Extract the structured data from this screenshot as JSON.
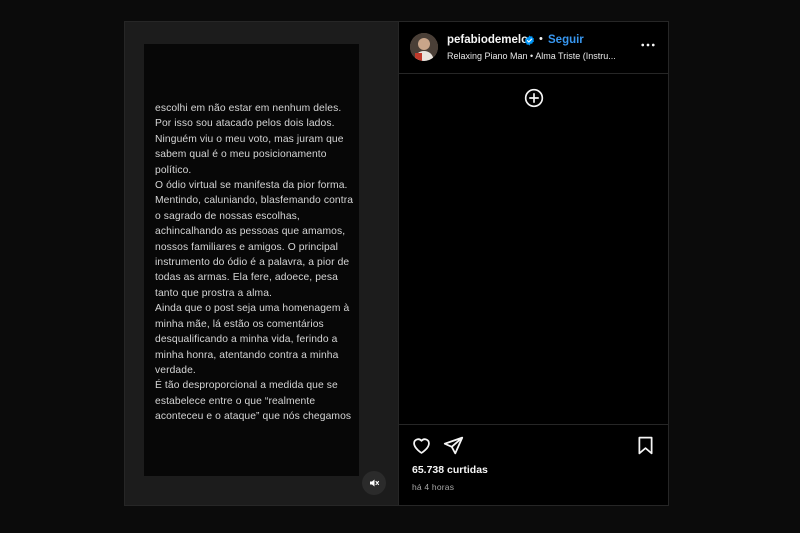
{
  "post": {
    "video": {
      "text": "escolhi em não estar em nenhum deles.\nPor isso sou atacado pelos dois lados.\nNinguém viu o meu voto, mas juram que sabem qual é o meu posicionamento político.\nO ódio virtual se manifesta da pior forma. Mentindo, caluniando, blasfemando contra o sagrado de nossas escolhas, achincalhando as pessoas que amamos, nossos familiares e amigos. O principal instrumento do ódio é a palavra, a pior de todas as armas. Ela fere, adoece, pesa tanto que prostra a alma.\nAinda que o post seja uma homenagem à minha mãe, lá estão os comentários desqualificando a minha vida, ferindo a minha honra, atentando contra a minha verdade.\nÉ tão desproporcional a medida que se estabelece entre o que “realmente aconteceu e o ataque” que nós chegamos",
      "mute_icon": "muted-speaker-icon"
    },
    "header": {
      "username": "pefabiodemelo",
      "separator": "•",
      "follow_label": "Seguir",
      "audio": "Relaxing Piano Man • Alma Triste (Instru...",
      "verified_color": "#0095f6",
      "follow_color": "#3897f0"
    },
    "actions": {
      "likes": "65.738 curtidas",
      "time": "há 4 horas"
    }
  }
}
